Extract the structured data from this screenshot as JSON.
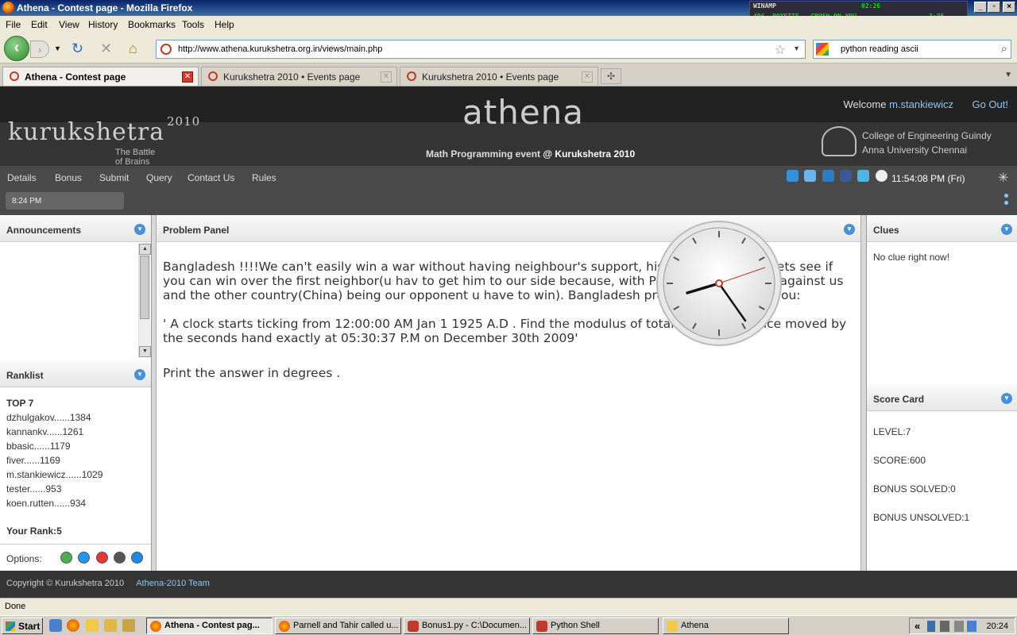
{
  "window": {
    "title": "Athena - Contest page - Mozilla Firefox"
  },
  "winamp": {
    "title": "WINAMP",
    "track": "496. ROXETTE - CRUSH ON YOU",
    "elapsed": "02:26",
    "duration": "3:35"
  },
  "menu": [
    "File",
    "Edit",
    "View",
    "History",
    "Bookmarks",
    "Tools",
    "Help"
  ],
  "nav": {
    "url": "http://www.athena.kurukshetra.org.in/views/main.php",
    "search": "python reading ascii"
  },
  "tabs": [
    {
      "label": "Athena - Contest page"
    },
    {
      "label": "Kurukshetra 2010 • Events page"
    },
    {
      "label": "Kurukshetra 2010 • Events page"
    }
  ],
  "site": {
    "welcome": "Welcome",
    "username": "m.stankiewicz",
    "goout": "Go Out!",
    "logo_text": "kurukshetra",
    "logo_year": "2010",
    "logo_sub": "The Battle of Brains",
    "athena": "athena",
    "event_prefix": "Math Programming event",
    "event_suffix": "@ Kurukshetra 2010",
    "college_line1": "College of Engineering Guindy",
    "college_line2": "Anna University Chennai",
    "navitems": [
      "Details",
      "Bonus",
      "Submit",
      "Query",
      "Contact Us",
      "Rules"
    ],
    "timer": "8:24 PM",
    "server_time": "11:54:08 PM (Fri)"
  },
  "panels": {
    "announcements": "Announcements",
    "ranklist": "Ranklist",
    "problem": "Problem Panel",
    "clues": "Clues",
    "scorecard": "Score Card"
  },
  "ranklist": {
    "heading": "TOP 7",
    "entries": [
      "dzhulgakov......1384",
      "kannankv......1261",
      "bbasic......1179",
      "fiver......1169",
      "m.stankiewicz......1029",
      "tester......953",
      "koen.rutten......934"
    ],
    "your_rank": "Your Rank:5",
    "options": "Options:"
  },
  "problem": {
    "p1": "Bangladesh !!!!We can't easily win a war without having neighbour's support, history says so. And lets see if you can win over the first neighbor(u hav to get him to our side because, with Pak, Srilanka turning against us and the other country(China) being our opponent u have to win). Bangladesh president ask this to you:",
    "p2": "' A clock starts ticking from 12:00:00 AM Jan 1 1925 A.D . Find the modulus of total angular distance moved by the seconds hand exactly at 05:30:37 P.M on December 30th 2009'",
    "p3": "Print the answer in degrees ."
  },
  "clues": {
    "text": "No clue right now!"
  },
  "scorecard": {
    "level": "LEVEL:7",
    "score": "SCORE:600",
    "bonus_solved": "BONUS SOLVED:0",
    "bonus_unsolved": "BONUS UNSOLVED:1"
  },
  "footer": {
    "copyright": "Copyright © Kurukshetra 2010",
    "team": "Athena-2010 Team"
  },
  "status": "Done",
  "taskbar": {
    "start": "Start",
    "tasks": [
      "Athena - Contest pag...",
      "Parnell and Tahir called u...",
      "Bonus1.py - C:\\Documen...",
      "Python Shell",
      "Athena"
    ],
    "clock": "20:24"
  },
  "colors": {
    "accent": "#8ec6f0",
    "header_dark": "#222222",
    "nav_gray": "#4a4a4a"
  }
}
